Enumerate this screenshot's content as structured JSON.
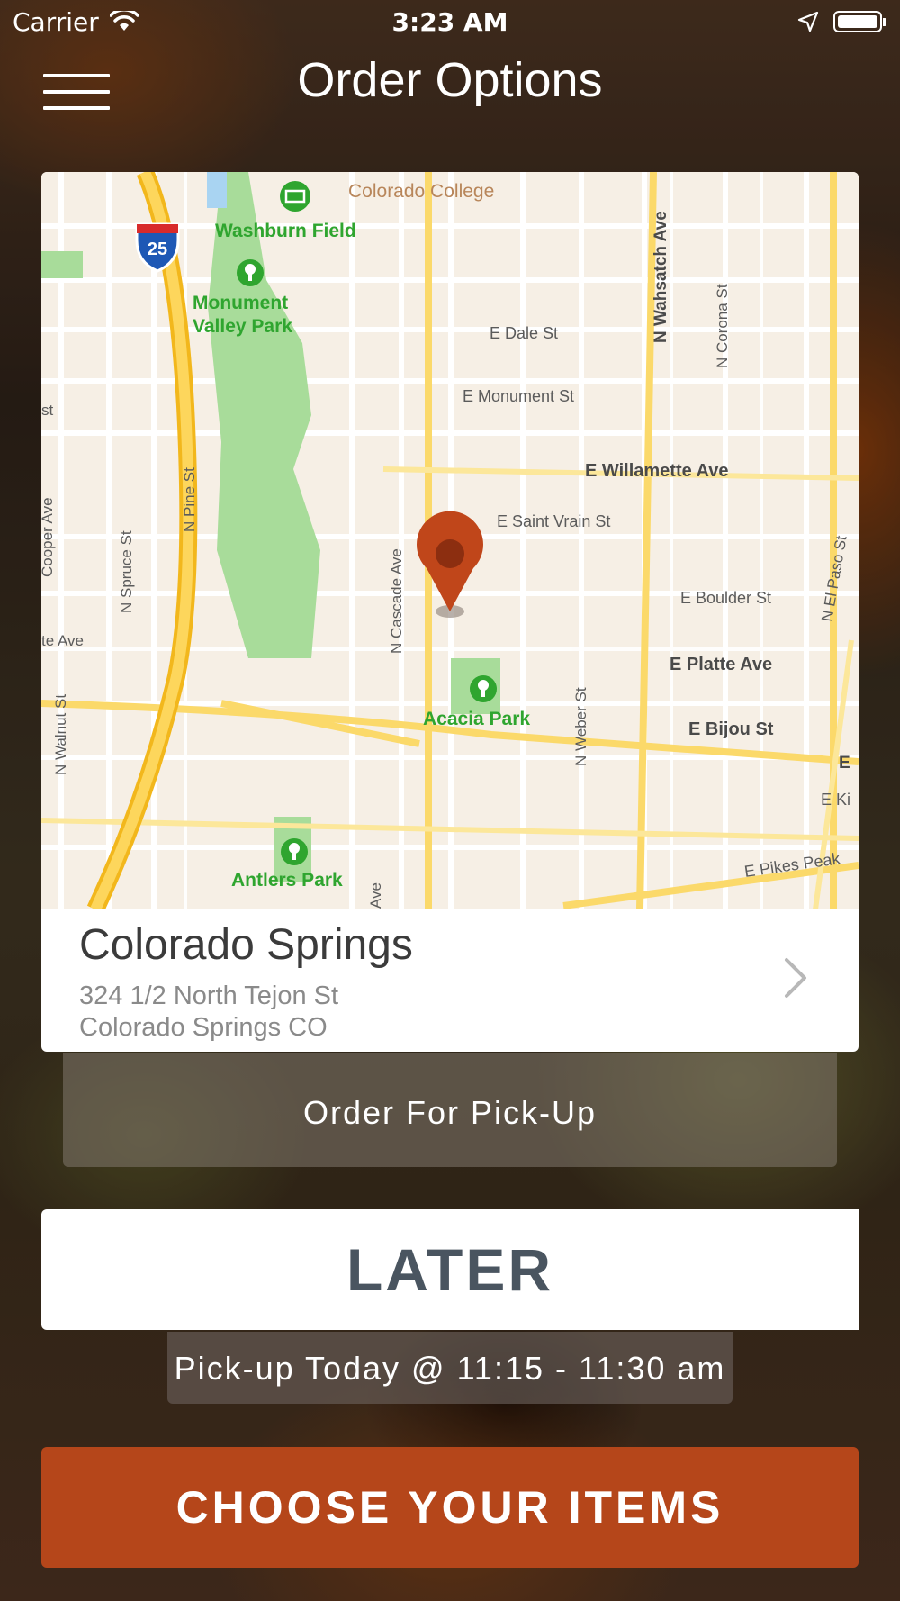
{
  "status_bar": {
    "carrier": "Carrier",
    "time": "3:23 AM"
  },
  "header": {
    "title": "Order Options"
  },
  "map": {
    "labels": {
      "college": "Colorado College",
      "washburn": "Washburn Field",
      "monument1": "Monument",
      "monument2": "Valley Park",
      "dale": "E Dale St",
      "monument_st": "E Monument St",
      "willamette": "E Willamette Ave",
      "saint_vrain": "E Saint Vrain St",
      "boulder": "E Boulder St",
      "platte": "E Platte Ave",
      "bijou": "E Bijou St",
      "acacia": "Acacia Park",
      "antlers": "Antlers Park",
      "pikes": "E Pikes Peak",
      "wahsatch": "N Wahsatch Ave",
      "corona": "N Corona St",
      "el_paso": "N El Paso St",
      "weber": "N Weber St",
      "cascade": "N Cascade Ave",
      "pine": "N Pine St",
      "spruce": "N Spruce St",
      "walnut": "N Walnut St",
      "cooper": "Cooper Ave",
      "te_ave": "te Ave",
      "ave_small": "Ave",
      "st_small": "st",
      "ki": "E Ki",
      "e_right": "E",
      "interstate": "25"
    },
    "colors": {
      "land": "#f6efe5",
      "park": "#a8dc9a",
      "major_road": "#fbd96a",
      "interstate": "#f7c83a",
      "pin": "#c0461a",
      "park_label": "#2fa52f",
      "street_label": "#5b5b5b"
    }
  },
  "location": {
    "name": "Colorado Springs",
    "address_line1": "324 1/2 North Tejon St",
    "address_line2": "Colorado Springs CO"
  },
  "order_type": {
    "label": "Order For Pick-Up"
  },
  "timing": {
    "label": "LATER",
    "pickup_time": "Pick-up Today @ 11:15 - 11:30 am"
  },
  "cta": {
    "label": "CHOOSE YOUR ITEMS"
  },
  "icons": [
    "wifi-icon",
    "location-arrow-icon",
    "battery-icon",
    "hamburger-menu-icon",
    "map-pin-icon",
    "chevron-right-icon",
    "interstate-shield-icon",
    "park-tree-icon",
    "stadium-icon"
  ]
}
